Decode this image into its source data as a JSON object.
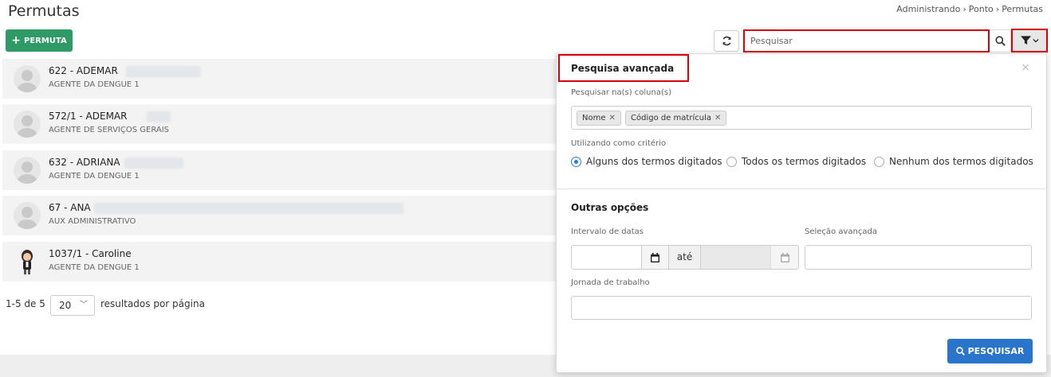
{
  "page": {
    "title": "Permutas"
  },
  "breadcrumb": [
    "Administrando",
    "Ponto",
    "Permutas"
  ],
  "toolbar": {
    "add_label": "PERMUTA",
    "search_placeholder": "Pesquisar"
  },
  "employees": [
    {
      "name": "622 - ADEMAR",
      "role": "AGENTE DA DENGUE 1",
      "avatar": "placeholder"
    },
    {
      "name": "572/1 - ADEMAR",
      "role": "AGENTE DE SERVIÇOS GERAIS",
      "avatar": "placeholder"
    },
    {
      "name": "632 - ADRIANA",
      "role": "AGENTE DA DENGUE 1",
      "avatar": "placeholder"
    },
    {
      "name": "67 - ANA",
      "role": "AUX ADMINISTRATIVO",
      "avatar": "placeholder"
    },
    {
      "name": "1037/1 - Caroline",
      "role": "AGENTE DA DENGUE 1",
      "avatar": "character"
    }
  ],
  "pagination": {
    "count_text": "1-5 de 5",
    "page_size": "20",
    "suffix": "resultados por página"
  },
  "advanced_search": {
    "title": "Pesquisa avançada",
    "close": "×",
    "columns_label": "Pesquisar na(s) coluna(s)",
    "columns": [
      "Nome",
      "Código de matrícula"
    ],
    "criteria_label": "Utilizando como critério",
    "criteria": [
      {
        "label": "Alguns dos termos digitados",
        "selected": true
      },
      {
        "label": "Todos os termos digitados",
        "selected": false
      },
      {
        "label": "Nenhum dos termos digitados",
        "selected": false
      }
    ],
    "other_title": "Outras opções",
    "date_range_label": "Intervalo de datas",
    "until_label": "até",
    "advanced_selection_label": "Seleção avançada",
    "workday_label": "Jornada de trabalho",
    "submit_label": "PESQUISAR"
  },
  "colors": {
    "primary_green": "#2e9a66",
    "primary_blue": "#2a75cc",
    "highlight_red": "#d9000d",
    "radio_blue": "#2a7ae2"
  }
}
